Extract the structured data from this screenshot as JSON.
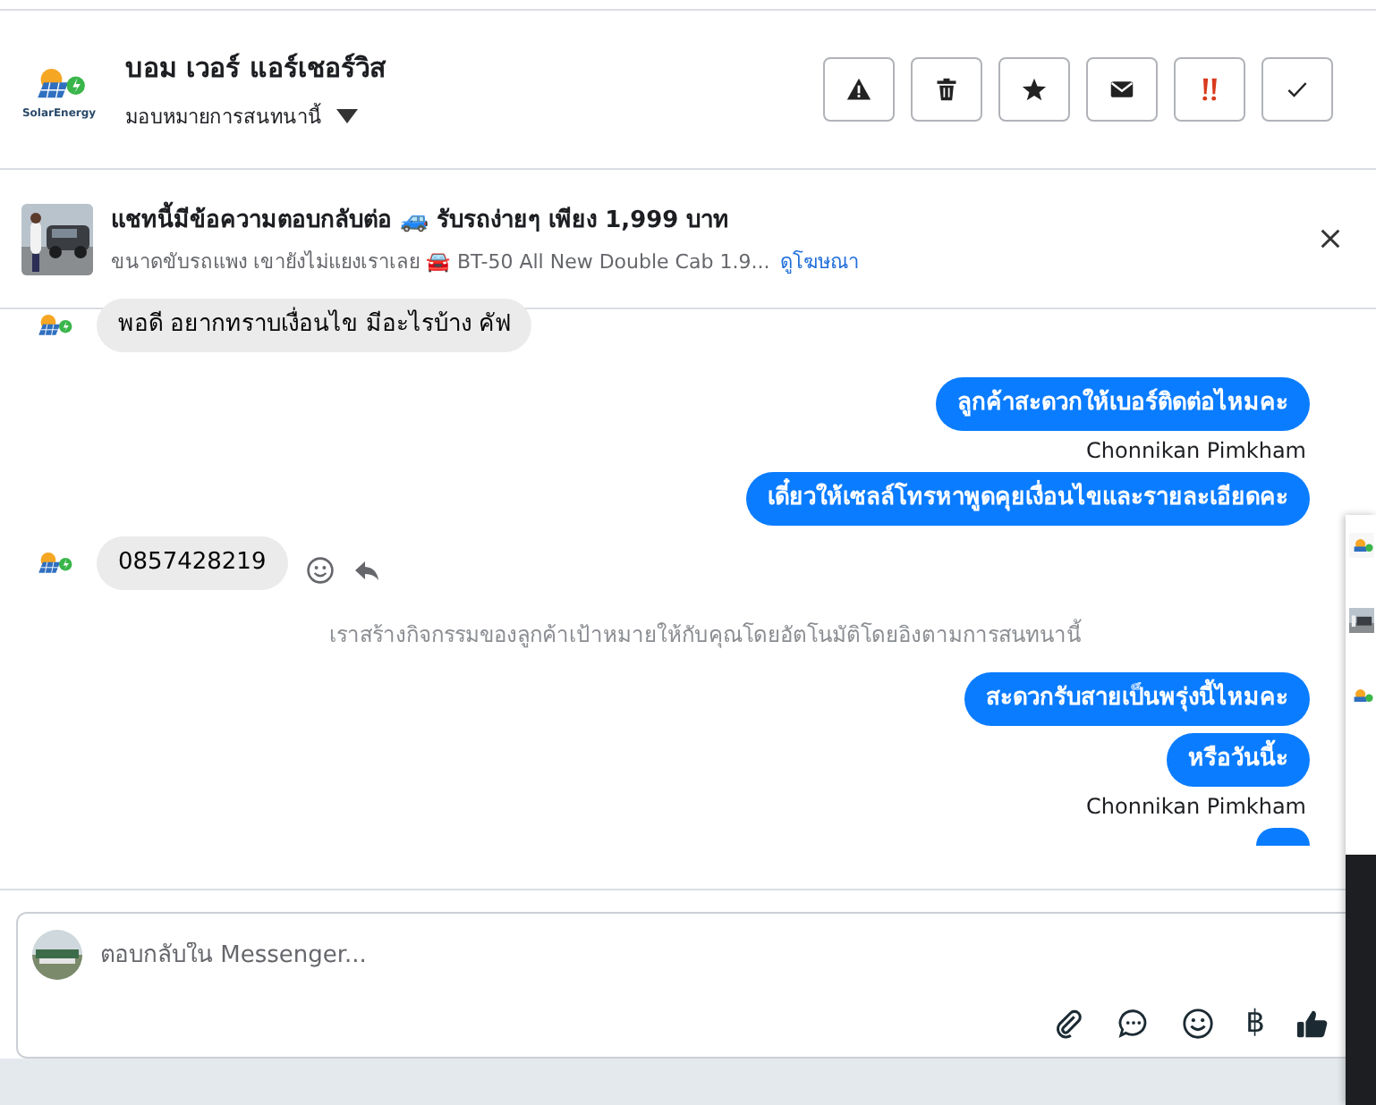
{
  "header": {
    "logo_text": "SolarEnergy",
    "name": "บอม เวอร์ แอร์เชอร์วิส",
    "assign_label": "มอบหมายการสนทนานี้",
    "actions": [
      {
        "kind": "warning"
      },
      {
        "kind": "trash"
      },
      {
        "kind": "star"
      },
      {
        "kind": "mail"
      },
      {
        "kind": "urgent"
      },
      {
        "kind": "check"
      }
    ]
  },
  "ad": {
    "title": "แชทนี้มีข้อความตอบกลับต่อ 🚙 รับรถง่ายๆ เพียง 1,999 บาท",
    "subtitle": "ขนาดขับรถแพง เขายังไม่แยงเราเลย 🚘 BT-50 All New Double Cab 1.9...",
    "link": "ดูโฆษณา"
  },
  "messages": [
    {
      "kind": "incoming",
      "text": "พอดี อยากทราบเงื่อนไข มีอะไรบ้าง คัฟ",
      "actions": false
    },
    {
      "kind": "outgoing",
      "text": "ลูกค้าสะดวกให้เบอร์ติดต่อไหมคะ"
    },
    {
      "kind": "sender",
      "text": "Chonnikan Pimkham"
    },
    {
      "kind": "outgoing",
      "text": "เดี๋ยวให้เซลล์โทรหาพูดคุยเงื่อนไขและรายละเอียดคะ"
    },
    {
      "kind": "incoming",
      "text": "0857428219",
      "actions": true
    },
    {
      "kind": "note",
      "text": "เราสร้างกิจกรรมของลูกค้าเป้าหมายให้กับคุณโดยอัตโนมัติโดยอิงตามการสนทนานี้"
    },
    {
      "kind": "outgoing",
      "text": "สะดวกรับสายเป็นพรุ่งนี้ไหมคะ"
    },
    {
      "kind": "outgoing",
      "text": "หรือวันนี้ะ"
    },
    {
      "kind": "sender",
      "text": "Chonnikan Pimkham"
    },
    {
      "kind": "outgoing-edge"
    }
  ],
  "composer": {
    "placeholder": "ตอบกลับใน Messenger...",
    "tools": [
      {
        "kind": "attach"
      },
      {
        "kind": "chat"
      },
      {
        "kind": "emoji"
      },
      {
        "kind": "currency",
        "symbol": "฿"
      },
      {
        "kind": "like"
      }
    ]
  }
}
